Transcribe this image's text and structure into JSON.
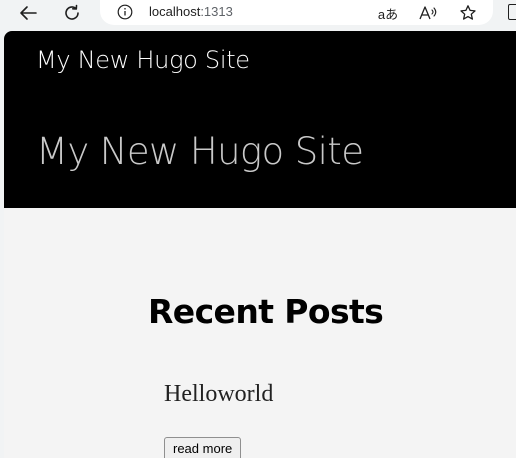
{
  "browser": {
    "url_host": "localhost",
    "url_port": ":1313",
    "icons": {
      "back": "back-arrow-icon",
      "reload": "reload-icon",
      "info": "info-icon",
      "translate": "translate-icon",
      "read_aloud": "read-aloud-icon",
      "favorite": "favorite-star-icon"
    },
    "translate_glyph": "aあ",
    "read_aloud_glyph": "A"
  },
  "site": {
    "nav_title": "My New Hugo Site",
    "hero_title": "My New Hugo Site",
    "colors": {
      "header_bg": "#000000",
      "page_bg": "#f4f4f4",
      "hero_text": "#c9c9c9"
    }
  },
  "main": {
    "heading": "Recent Posts",
    "posts": [
      {
        "title": "Helloworld",
        "read_more_label": "read more"
      }
    ]
  }
}
